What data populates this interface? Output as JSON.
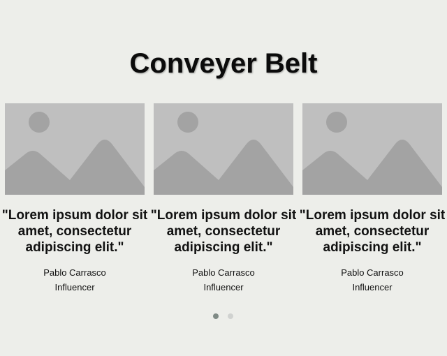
{
  "header": {
    "title": "Conveyer Belt"
  },
  "cards": [
    {
      "image_icon": "image-placeholder-icon",
      "quote": "\"Lorem ipsum dolor sit amet, consectetur adipiscing elit.\"",
      "name": "Pablo Carrasco",
      "role": "Influencer"
    },
    {
      "image_icon": "image-placeholder-icon",
      "quote": "\"Lorem ipsum dolor sit amet, consectetur adipiscing elit.\"",
      "name": "Pablo Carrasco",
      "role": "Influencer"
    },
    {
      "image_icon": "image-placeholder-icon",
      "quote": "\"Lorem ipsum dolor sit amet, consectetur adipiscing elit.\"",
      "name": "Pablo Carrasco",
      "role": "Influencer"
    }
  ],
  "pagination": {
    "count": 2,
    "active_index": 0
  },
  "colors": {
    "background": "#edeeea",
    "placeholder_bg": "#bfbfbf",
    "placeholder_shape": "#a3a3a3",
    "dot_active": "#7f8a85",
    "dot_inactive": "#d0d2d0"
  }
}
